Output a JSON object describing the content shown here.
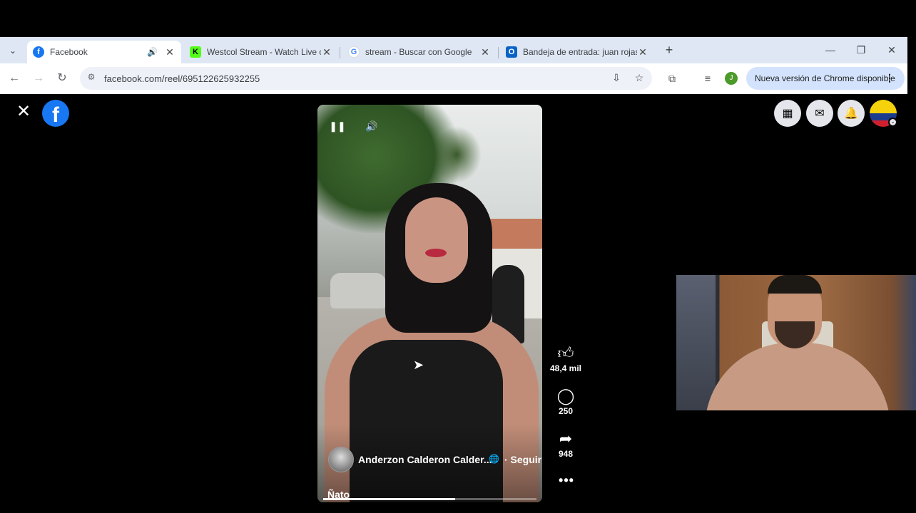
{
  "browser": {
    "tabs": [
      {
        "title": "Facebook",
        "favicon": "facebook-icon",
        "active": true,
        "audio": true
      },
      {
        "title": "Westcol Stream - Watch Live on",
        "favicon": "kick-icon",
        "active": false
      },
      {
        "title": "stream - Buscar con Google",
        "favicon": "google-icon",
        "active": false
      },
      {
        "title": "Bandeja de entrada: juan rojas",
        "favicon": "outlook-icon",
        "active": false
      }
    ],
    "url": "facebook.com/reel/695122625932255",
    "profile_initial": "J",
    "update_label": "Nueva versión de Chrome disponible"
  },
  "reel": {
    "author": "Anderzon Calderon Calder...",
    "follow_label": "· Seguir",
    "caption": "Ñato",
    "progress_fraction": 0.62,
    "actions": {
      "likes": "48,4 mil",
      "comments": "250",
      "shares": "948"
    }
  },
  "colors": {
    "facebook_blue": "#1877f2",
    "tabstrip_bg": "#dfe7f4",
    "update_pill": "#d3e3fd",
    "profile_green": "#4c9a2a"
  }
}
